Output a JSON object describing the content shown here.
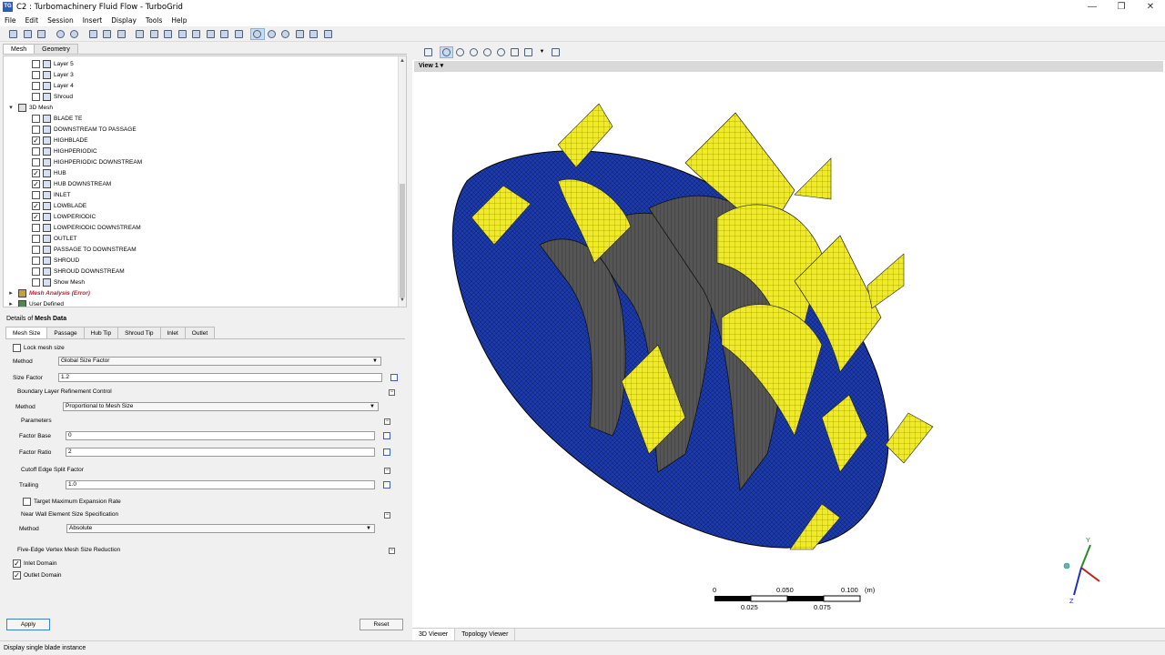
{
  "window": {
    "title": "C2 : Turbomachinery Fluid Flow - TurboGrid",
    "app_badge": "TG",
    "min": "—",
    "max": "❐",
    "close": "✕"
  },
  "menu": [
    "File",
    "Edit",
    "Session",
    "Insert",
    "Display",
    "Tools",
    "Help"
  ],
  "left_tabs": [
    "Mesh",
    "Geometry"
  ],
  "tree": [
    {
      "label": "Layer 5",
      "indent": 2,
      "checkbox": true,
      "checked": false,
      "icon": "layer"
    },
    {
      "label": "Layer 3",
      "indent": 2,
      "checkbox": true,
      "checked": false,
      "icon": "layer"
    },
    {
      "label": "Layer 4",
      "indent": 2,
      "checkbox": true,
      "checked": false,
      "icon": "layer"
    },
    {
      "label": "Shroud",
      "indent": 2,
      "checkbox": true,
      "checked": false,
      "icon": "layer"
    },
    {
      "label": "3D Mesh",
      "indent": 1,
      "checkbox": false,
      "expander": "▾",
      "icon": "mesh"
    },
    {
      "label": "BLADE TE",
      "indent": 2,
      "checkbox": true,
      "checked": false,
      "icon": "layer"
    },
    {
      "label": "DOWNSTREAM TO PASSAGE",
      "indent": 2,
      "checkbox": true,
      "checked": false,
      "icon": "layer"
    },
    {
      "label": "HIGHBLADE",
      "indent": 2,
      "checkbox": true,
      "checked": true,
      "icon": "layer"
    },
    {
      "label": "HIGHPERIODIC",
      "indent": 2,
      "checkbox": true,
      "checked": false,
      "icon": "layer"
    },
    {
      "label": "HIGHPERIODIC DOWNSTREAM",
      "indent": 2,
      "checkbox": true,
      "checked": false,
      "icon": "layer"
    },
    {
      "label": "HUB",
      "indent": 2,
      "checkbox": true,
      "checked": true,
      "icon": "layer"
    },
    {
      "label": "HUB DOWNSTREAM",
      "indent": 2,
      "checkbox": true,
      "checked": true,
      "icon": "layer"
    },
    {
      "label": "INLET",
      "indent": 2,
      "checkbox": true,
      "checked": false,
      "icon": "layer"
    },
    {
      "label": "LOWBLADE",
      "indent": 2,
      "checkbox": true,
      "checked": true,
      "icon": "layer"
    },
    {
      "label": "LOWPERIODIC",
      "indent": 2,
      "checkbox": true,
      "checked": true,
      "icon": "layer"
    },
    {
      "label": "LOWPERIODIC DOWNSTREAM",
      "indent": 2,
      "checkbox": true,
      "checked": false,
      "icon": "layer"
    },
    {
      "label": "OUTLET",
      "indent": 2,
      "checkbox": true,
      "checked": false,
      "icon": "layer"
    },
    {
      "label": "PASSAGE TO DOWNSTREAM",
      "indent": 2,
      "checkbox": true,
      "checked": false,
      "icon": "layer"
    },
    {
      "label": "SHROUD",
      "indent": 2,
      "checkbox": true,
      "checked": false,
      "icon": "layer"
    },
    {
      "label": "SHROUD DOWNSTREAM",
      "indent": 2,
      "checkbox": true,
      "checked": false,
      "icon": "layer"
    },
    {
      "label": "Show Mesh",
      "indent": 2,
      "checkbox": true,
      "checked": false,
      "icon": "layer"
    },
    {
      "label": "Mesh Analysis (Error)",
      "indent": 1,
      "checkbox": false,
      "expander": "▸",
      "icon": "err",
      "error": true
    },
    {
      "label": "User Defined",
      "indent": 1,
      "checkbox": false,
      "expander": "▸",
      "icon": "folder"
    }
  ],
  "details": {
    "prefix": "Details of ",
    "title": "Mesh Data",
    "tabs": [
      "Mesh Size",
      "Passage",
      "Hub Tip",
      "Shroud Tip",
      "Inlet",
      "Outlet"
    ],
    "lock_mesh_size": "Lock mesh size",
    "method_label": "Method",
    "method_value": "Global Size Factor",
    "size_factor_label": "Size Factor",
    "size_factor_value": "1.2",
    "blrc_label": "Boundary Layer Refinement Control",
    "blrc_method_label": "Method",
    "blrc_method_value": "Proportional to Mesh Size",
    "parameters_label": "Parameters",
    "factor_base_label": "Factor Base",
    "factor_base_value": "0",
    "factor_ratio_label": "Factor Ratio",
    "factor_ratio_value": "2",
    "cutoff_label": "Cutoff Edge Split Factor",
    "trailing_label": "Trailing",
    "trailing_value": "1.0",
    "target_max_label": "Target Maximum Expansion Rate",
    "near_wall_label": "Near Wall Element Size Specification",
    "near_wall_method_label": "Method",
    "near_wall_method_value": "Absolute",
    "five_edge_label": "Five-Edge Vertex Mesh Size Reduction",
    "inlet_domain_label": "Inlet Domain",
    "outlet_domain_label": "Outlet Domain",
    "apply": "Apply",
    "reset": "Reset"
  },
  "viewer": {
    "view_label": "View 1",
    "tabs": [
      "3D Viewer",
      "Topology Viewer"
    ],
    "scale": {
      "top": [
        "0",
        "0.050",
        "0.100"
      ],
      "unit": "(m)",
      "bottom": [
        "0.025",
        "0.075"
      ]
    },
    "axes": {
      "y": "Y",
      "z": "Z"
    }
  },
  "status": "Display single blade instance",
  "colors": {
    "hub": "#1c3aa8",
    "blade": "#f0ea2c",
    "dark": "#3a3a3a"
  }
}
